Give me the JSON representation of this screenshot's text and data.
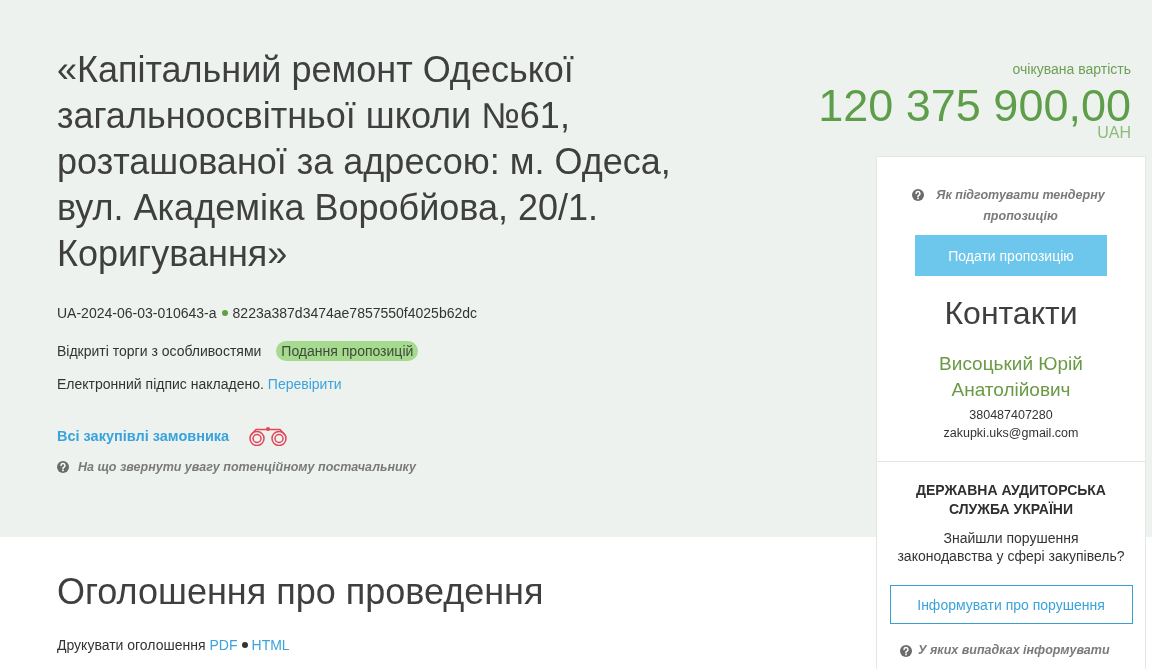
{
  "tender": {
    "title": "«Капітальний ремонт Одеської загальноосвітньої школи №61, розташованої за адресою: м. Одеса, вул. Академіка Воробйова, 20/1. Коригування»",
    "tender_id": "UA-2024-06-03-010643-a",
    "hash": "8223a387d3474ae7857550f4025b62dc",
    "procedure_type": "Відкриті торги з особливостями",
    "status": "Подання пропозицій",
    "signature": {
      "text": "Електронний підпис накладено.",
      "link": "Перевірити"
    },
    "buyer_link": "Всі закупівлі замовника",
    "help_link": "На що звернути увагу потенційному постачальнику"
  },
  "price": {
    "label": "очікувана вартість",
    "amount": "120 375 900,00",
    "currency": "UAH"
  },
  "sidebar": {
    "help_link": "Як підготувати тендерну пропозицію",
    "submit_button": "Подати пропозицію",
    "contacts": {
      "heading": "Контакти",
      "name": "Висоцький Юрій Анатолійович",
      "phone": "380487407280",
      "email": "zakupki.uks@gmail.com"
    },
    "audit": {
      "heading": "ДЕРЖАВНА АУДИТОРСЬКА СЛУЖБА УКРАЇНИ",
      "text": "Знайшли порушення законодавства у сфері закупівель?",
      "report_button": "Інформувати про порушення",
      "help_link": "У яких випадках інформувати"
    }
  },
  "announcement": {
    "heading": "Оголошення про проведення",
    "print_label": "Друкувати оголошення",
    "print_links": [
      "PDF",
      "HTML"
    ]
  }
}
